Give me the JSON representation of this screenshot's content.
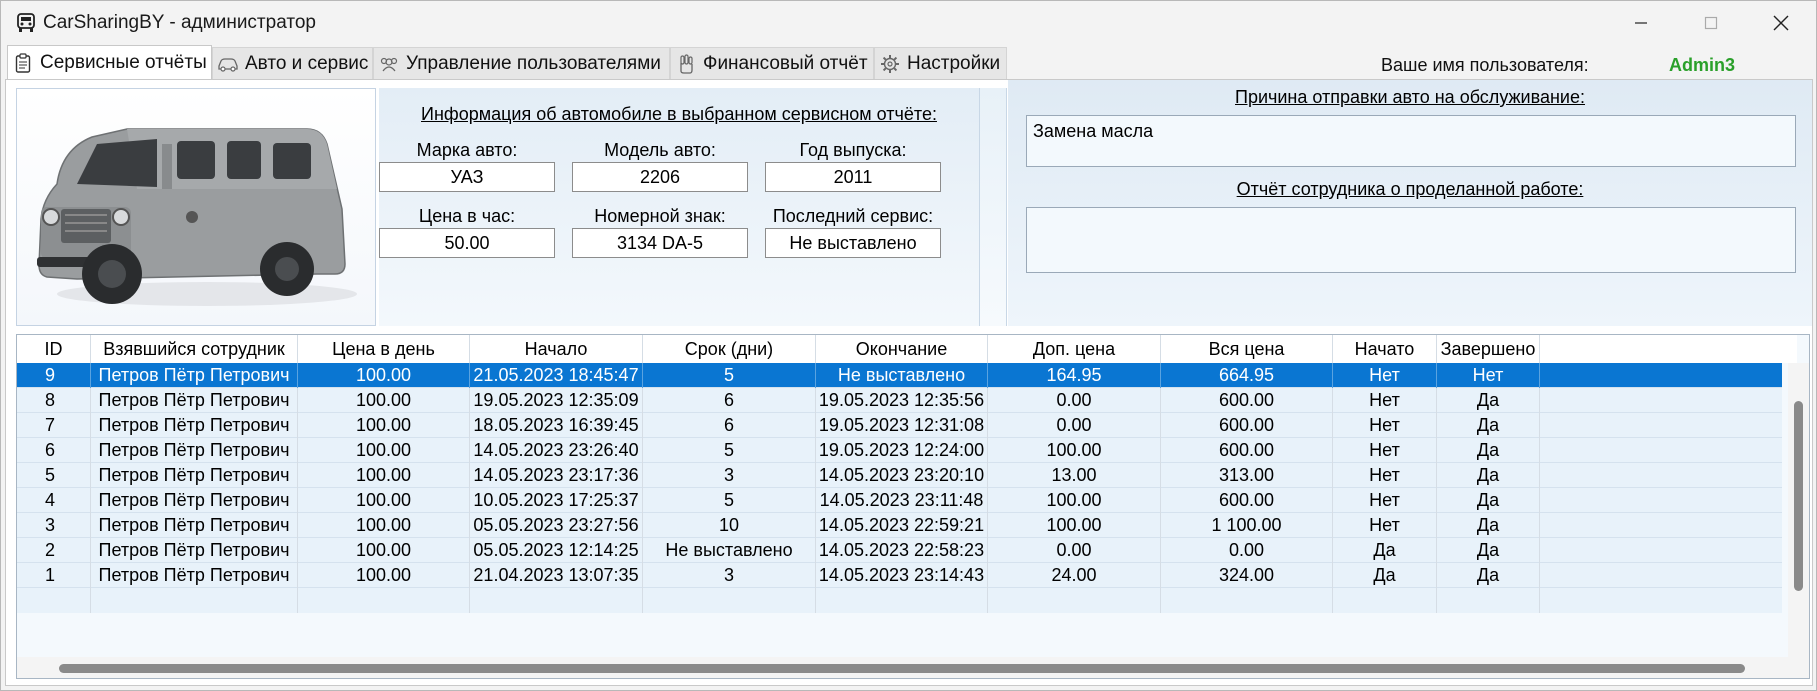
{
  "window": {
    "title": "CarSharingBY - администратор",
    "app_icon": "car-icon",
    "controls": [
      "minimize",
      "maximize",
      "close"
    ]
  },
  "tabs": [
    {
      "label": "Сервисные отчёты",
      "icon": "clipboard-icon",
      "active": true
    },
    {
      "label": "Авто и сервис",
      "icon": "car-icon",
      "active": false
    },
    {
      "label": "Управление пользователями",
      "icon": "users-icon",
      "active": false
    },
    {
      "label": "Финансовый отчёт",
      "icon": "finance-icon",
      "active": false
    },
    {
      "label": "Настройки",
      "icon": "gear-icon",
      "active": false
    }
  ],
  "user": {
    "label": "Ваше имя пользователя:",
    "name": "Admin3",
    "name_color": "#2aa02a"
  },
  "car_info": {
    "heading": "Информация об автомобиле в выбранном сервисном отчёте:",
    "brand_label": "Марка авто:",
    "brand": "УАЗ",
    "model_label": "Модель авто:",
    "model": "2206",
    "year_label": "Год выпуска:",
    "year": "2011",
    "price_label": "Цена в час:",
    "price": "50.00",
    "plate_label": "Номерной знак:",
    "plate": "3134 DA-5",
    "last_service_label": "Последний сервис:",
    "last_service": "Не выставлено"
  },
  "service": {
    "reason_heading": "Причина отправки авто на обслуживание:",
    "reason": "Замена масла",
    "report_heading": "Отчёт сотрудника о проделанной работе:",
    "report": ""
  },
  "table": {
    "columns": [
      "ID",
      "Взявшийся сотрудник",
      "Цена в день",
      "Начало",
      "Срок (дни)",
      "Окончание",
      "Доп. цена",
      "Вся цена",
      "Начато",
      "Завершено"
    ],
    "selected_row": 0,
    "selected_color": "#0a76d2",
    "rows": [
      [
        "9",
        "Петров Пётр Петрович",
        "100.00",
        "21.05.2023 18:45:47",
        "5",
        "Не выставлено",
        "164.95",
        "664.95",
        "Нет",
        "Нет"
      ],
      [
        "8",
        "Петров Пётр Петрович",
        "100.00",
        "19.05.2023 12:35:09",
        "6",
        "19.05.2023 12:35:56",
        "0.00",
        "600.00",
        "Нет",
        "Да"
      ],
      [
        "7",
        "Петров Пётр Петрович",
        "100.00",
        "18.05.2023 16:39:45",
        "6",
        "19.05.2023 12:31:08",
        "0.00",
        "600.00",
        "Нет",
        "Да"
      ],
      [
        "6",
        "Петров Пётр Петрович",
        "100.00",
        "14.05.2023 23:26:40",
        "5",
        "19.05.2023 12:24:00",
        "100.00",
        "600.00",
        "Нет",
        "Да"
      ],
      [
        "5",
        "Петров Пётр Петрович",
        "100.00",
        "14.05.2023 23:17:36",
        "3",
        "14.05.2023 23:20:10",
        "13.00",
        "313.00",
        "Нет",
        "Да"
      ],
      [
        "4",
        "Петров Пётр Петрович",
        "100.00",
        "10.05.2023 17:25:37",
        "5",
        "14.05.2023 23:11:48",
        "100.00",
        "600.00",
        "Нет",
        "Да"
      ],
      [
        "3",
        "Петров Пётр Петрович",
        "100.00",
        "05.05.2023 23:27:56",
        "10",
        "14.05.2023 22:59:21",
        "100.00",
        "1 100.00",
        "Нет",
        "Да"
      ],
      [
        "2",
        "Петров Пётр Петрович",
        "100.00",
        "05.05.2023 12:14:25",
        "Не выставлено",
        "14.05.2023 22:58:23",
        "0.00",
        "0.00",
        "Да",
        "Да"
      ],
      [
        "1",
        "Петров Пётр Петрович",
        "100.00",
        "21.04.2023 13:07:35",
        "3",
        "14.05.2023 23:14:43",
        "24.00",
        "324.00",
        "Да",
        "Да"
      ]
    ]
  }
}
